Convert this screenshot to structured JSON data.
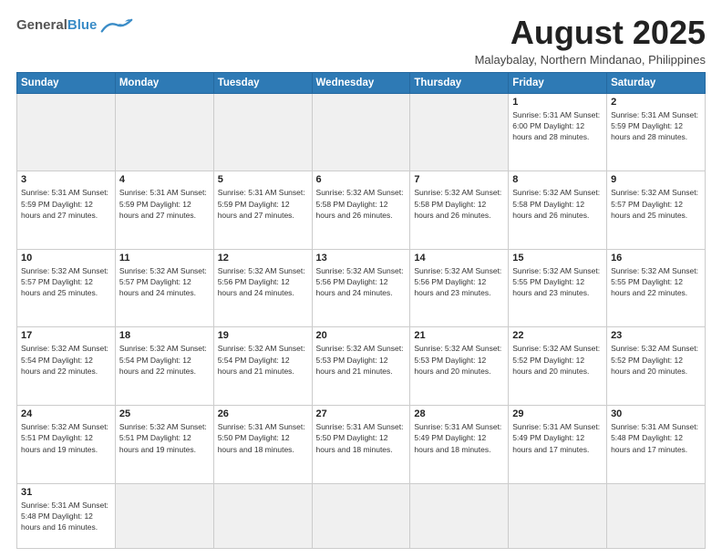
{
  "header": {
    "logo_line1": "General",
    "logo_line2": "Blue",
    "month_title": "August 2025",
    "location": "Malaybalay, Northern Mindanao, Philippines"
  },
  "weekdays": [
    "Sunday",
    "Monday",
    "Tuesday",
    "Wednesday",
    "Thursday",
    "Friday",
    "Saturday"
  ],
  "weeks": [
    [
      {
        "day": "",
        "info": ""
      },
      {
        "day": "",
        "info": ""
      },
      {
        "day": "",
        "info": ""
      },
      {
        "day": "",
        "info": ""
      },
      {
        "day": "",
        "info": ""
      },
      {
        "day": "1",
        "info": "Sunrise: 5:31 AM\nSunset: 6:00 PM\nDaylight: 12 hours\nand 28 minutes."
      },
      {
        "day": "2",
        "info": "Sunrise: 5:31 AM\nSunset: 5:59 PM\nDaylight: 12 hours\nand 28 minutes."
      }
    ],
    [
      {
        "day": "3",
        "info": "Sunrise: 5:31 AM\nSunset: 5:59 PM\nDaylight: 12 hours\nand 27 minutes."
      },
      {
        "day": "4",
        "info": "Sunrise: 5:31 AM\nSunset: 5:59 PM\nDaylight: 12 hours\nand 27 minutes."
      },
      {
        "day": "5",
        "info": "Sunrise: 5:31 AM\nSunset: 5:59 PM\nDaylight: 12 hours\nand 27 minutes."
      },
      {
        "day": "6",
        "info": "Sunrise: 5:32 AM\nSunset: 5:58 PM\nDaylight: 12 hours\nand 26 minutes."
      },
      {
        "day": "7",
        "info": "Sunrise: 5:32 AM\nSunset: 5:58 PM\nDaylight: 12 hours\nand 26 minutes."
      },
      {
        "day": "8",
        "info": "Sunrise: 5:32 AM\nSunset: 5:58 PM\nDaylight: 12 hours\nand 26 minutes."
      },
      {
        "day": "9",
        "info": "Sunrise: 5:32 AM\nSunset: 5:57 PM\nDaylight: 12 hours\nand 25 minutes."
      }
    ],
    [
      {
        "day": "10",
        "info": "Sunrise: 5:32 AM\nSunset: 5:57 PM\nDaylight: 12 hours\nand 25 minutes."
      },
      {
        "day": "11",
        "info": "Sunrise: 5:32 AM\nSunset: 5:57 PM\nDaylight: 12 hours\nand 24 minutes."
      },
      {
        "day": "12",
        "info": "Sunrise: 5:32 AM\nSunset: 5:56 PM\nDaylight: 12 hours\nand 24 minutes."
      },
      {
        "day": "13",
        "info": "Sunrise: 5:32 AM\nSunset: 5:56 PM\nDaylight: 12 hours\nand 24 minutes."
      },
      {
        "day": "14",
        "info": "Sunrise: 5:32 AM\nSunset: 5:56 PM\nDaylight: 12 hours\nand 23 minutes."
      },
      {
        "day": "15",
        "info": "Sunrise: 5:32 AM\nSunset: 5:55 PM\nDaylight: 12 hours\nand 23 minutes."
      },
      {
        "day": "16",
        "info": "Sunrise: 5:32 AM\nSunset: 5:55 PM\nDaylight: 12 hours\nand 22 minutes."
      }
    ],
    [
      {
        "day": "17",
        "info": "Sunrise: 5:32 AM\nSunset: 5:54 PM\nDaylight: 12 hours\nand 22 minutes."
      },
      {
        "day": "18",
        "info": "Sunrise: 5:32 AM\nSunset: 5:54 PM\nDaylight: 12 hours\nand 22 minutes."
      },
      {
        "day": "19",
        "info": "Sunrise: 5:32 AM\nSunset: 5:54 PM\nDaylight: 12 hours\nand 21 minutes."
      },
      {
        "day": "20",
        "info": "Sunrise: 5:32 AM\nSunset: 5:53 PM\nDaylight: 12 hours\nand 21 minutes."
      },
      {
        "day": "21",
        "info": "Sunrise: 5:32 AM\nSunset: 5:53 PM\nDaylight: 12 hours\nand 20 minutes."
      },
      {
        "day": "22",
        "info": "Sunrise: 5:32 AM\nSunset: 5:52 PM\nDaylight: 12 hours\nand 20 minutes."
      },
      {
        "day": "23",
        "info": "Sunrise: 5:32 AM\nSunset: 5:52 PM\nDaylight: 12 hours\nand 20 minutes."
      }
    ],
    [
      {
        "day": "24",
        "info": "Sunrise: 5:32 AM\nSunset: 5:51 PM\nDaylight: 12 hours\nand 19 minutes."
      },
      {
        "day": "25",
        "info": "Sunrise: 5:32 AM\nSunset: 5:51 PM\nDaylight: 12 hours\nand 19 minutes."
      },
      {
        "day": "26",
        "info": "Sunrise: 5:31 AM\nSunset: 5:50 PM\nDaylight: 12 hours\nand 18 minutes."
      },
      {
        "day": "27",
        "info": "Sunrise: 5:31 AM\nSunset: 5:50 PM\nDaylight: 12 hours\nand 18 minutes."
      },
      {
        "day": "28",
        "info": "Sunrise: 5:31 AM\nSunset: 5:49 PM\nDaylight: 12 hours\nand 18 minutes."
      },
      {
        "day": "29",
        "info": "Sunrise: 5:31 AM\nSunset: 5:49 PM\nDaylight: 12 hours\nand 17 minutes."
      },
      {
        "day": "30",
        "info": "Sunrise: 5:31 AM\nSunset: 5:48 PM\nDaylight: 12 hours\nand 17 minutes."
      }
    ],
    [
      {
        "day": "31",
        "info": "Sunrise: 5:31 AM\nSunset: 5:48 PM\nDaylight: 12 hours\nand 16 minutes."
      },
      {
        "day": "",
        "info": ""
      },
      {
        "day": "",
        "info": ""
      },
      {
        "day": "",
        "info": ""
      },
      {
        "day": "",
        "info": ""
      },
      {
        "day": "",
        "info": ""
      },
      {
        "day": "",
        "info": ""
      }
    ]
  ]
}
